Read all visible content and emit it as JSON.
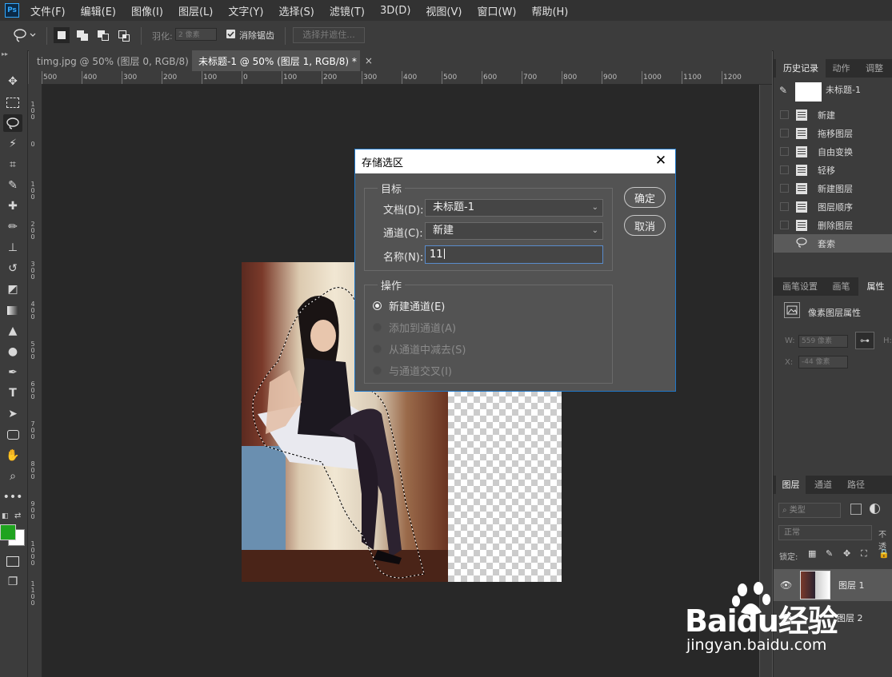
{
  "app": {
    "logo": "Ps"
  },
  "menu": [
    "文件(F)",
    "编辑(E)",
    "图像(I)",
    "图层(L)",
    "文字(Y)",
    "选择(S)",
    "滤镜(T)",
    "3D(D)",
    "视图(V)",
    "窗口(W)",
    "帮助(H)"
  ],
  "options": {
    "feather_label": "羽化:",
    "feather_value": "2 像素",
    "antialias_label": "消除锯齿",
    "select_mask_label": "选择并遮住..."
  },
  "tabs": [
    {
      "label": "timg.jpg @ 50% (图层 0, RGB/8) *",
      "close": "×"
    },
    {
      "label": "未标题-1 @ 50% (图层 1, RGB/8) *",
      "close": "×"
    }
  ],
  "ruler": {
    "h_labels": [
      "500",
      "400",
      "300",
      "200",
      "100",
      "0",
      "100",
      "200",
      "300",
      "400",
      "500",
      "600",
      "700",
      "800",
      "900",
      "1000",
      "1100",
      "1200"
    ],
    "v_labels": [
      "100",
      "0",
      "100",
      "200",
      "300",
      "400",
      "500",
      "600",
      "700",
      "800",
      "900",
      "1000",
      "1100"
    ]
  },
  "dialog": {
    "title": "存储选区",
    "close": "✕",
    "target_group": "目标",
    "doc_label": "文档(D):",
    "doc_value": "未标题-1",
    "channel_label": "通道(C):",
    "channel_value": "新建",
    "name_label": "名称(N):",
    "name_value": "11",
    "ok": "确定",
    "cancel": "取消",
    "op_group": "操作",
    "ops": [
      {
        "label": "新建通道(E)",
        "selected": true,
        "enabled": true
      },
      {
        "label": "添加到通道(A)",
        "selected": false,
        "enabled": false
      },
      {
        "label": "从通道中减去(S)",
        "selected": false,
        "enabled": false
      },
      {
        "label": "与通道交叉(I)",
        "selected": false,
        "enabled": false
      }
    ]
  },
  "history_panel": {
    "tabs": [
      "历史记录",
      "动作",
      "调整"
    ],
    "snapshot": "未标题-1",
    "items": [
      "新建",
      "拖移图层",
      "自由变换",
      "轻移",
      "新建图层",
      "图层顺序",
      "删除图层",
      "套索"
    ],
    "selected_item": "套索"
  },
  "properties_panel": {
    "tabs": [
      "画笔设置",
      "画笔",
      "属性"
    ],
    "title": "像素图层属性",
    "w_label": "W:",
    "w_value": "559 像素",
    "h_label": "H:",
    "x_label": "X:",
    "x_value": "-44 像素"
  },
  "layers_panel": {
    "tabs": [
      "图层",
      "通道",
      "路径"
    ],
    "filter_label": "类型",
    "blend_mode": "正常",
    "opacity_label": "不透",
    "lock_label": "锁定:",
    "layers": [
      {
        "name": "图层 1",
        "selected": true
      },
      {
        "name": "图层 2",
        "selected": false
      }
    ]
  },
  "watermark": {
    "brand": "Baidu经验",
    "url": "jingyan.baidu.com"
  },
  "colors": {
    "foreground": "#1fa31f",
    "background": "#ffffff",
    "dialog_border": "#1f77c8"
  }
}
